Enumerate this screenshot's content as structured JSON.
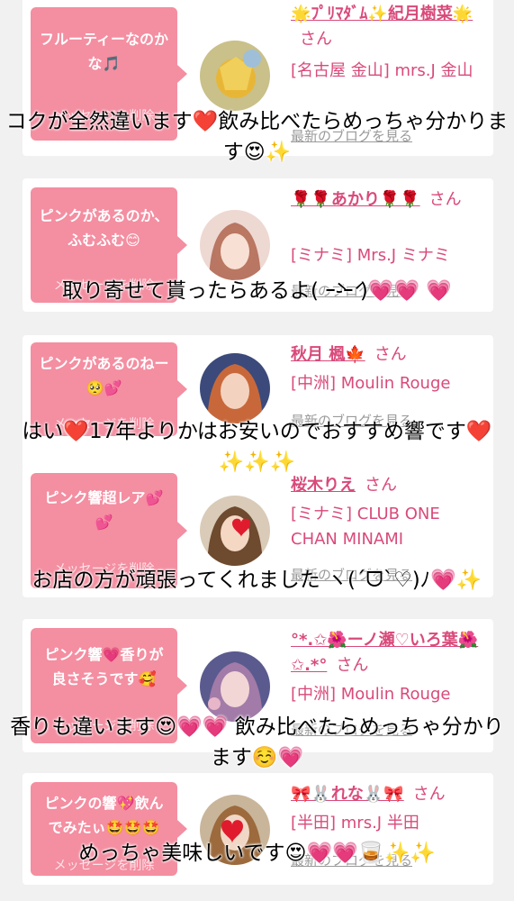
{
  "cards": [
    {
      "message": "フルーティーなのかな🎵",
      "delete_label": "メッセージを削除",
      "hostess_name": "🌟ﾌﾟﾘﾏﾀﾞﾑ✨紀月樹菜🌟",
      "san": "さん",
      "shop": "[名古屋 金山] mrs.J 金山",
      "blog_link": "最新のブログを見る",
      "overlay": "コクが全然違います❤️飲み比べたらめっちゃ分かります😍✨"
    },
    {
      "message": "ピンクがあるのか、ふむふむ😊",
      "delete_label": "メッセージを削除",
      "hostess_name": "🌹🌹あかり🌹🌹",
      "san": "さん",
      "shop": "[ミナミ] Mrs.J ミナミ",
      "blog_link": "最新のブログを見る",
      "overlay": "取り寄せて貰ったらあるよ( ｰ̀֊ｰ́ )💗💗 💗"
    },
    {
      "message": "ピンクがあるのねー🥺💕",
      "delete_label": "メッセージを削除",
      "hostess_name": "秋月 楓🍁",
      "san": "さん",
      "shop": "[中洲] Moulin Rouge",
      "blog_link": "最新のブログを見る",
      "overlay": "はい❤️17年よりかはお安いのでおすすめ響です❤️✨✨✨"
    },
    {
      "message": "ピンク響超レア💕💕",
      "delete_label": "メッセージを削除",
      "hostess_name": "桜木りえ",
      "san": "さん",
      "shop": "[ミナミ] CLUB ONE CHAN MINAMI",
      "blog_link": "最新のブログを見る",
      "overlay": "お店の方が頑張ってくれました ヽ(ˊᗜˋ♡)ﾉ💗✨"
    },
    {
      "message": "ピンク響💗香りが良さそうです🥰",
      "delete_label": "メッセージを削除",
      "hostess_name": "°*.✩🌺ーノ瀬♡いろ葉🌺✩.*°",
      "san": "さん",
      "shop": "[中洲] Moulin Rouge",
      "blog_link": "最新のブログを見る",
      "overlay": "香りも違います😍💗💗 飲み比べたらめっちゃ分かります☺️💗"
    },
    {
      "message": "ピンクの響💖飲んでみたぃ🤩🤩🤩",
      "delete_label": "メッセージを削除",
      "hostess_name": "🎀🐰れな🐰🎀",
      "san": "さん",
      "shop": "[半田] mrs.J 半田",
      "blog_link": "最新のブログを見る",
      "overlay": "めっちゃ美味しいです😍💗💗🥃✨✨"
    }
  ],
  "colors": {
    "bubble": "#f48ea1",
    "name": "#d94a7a",
    "background": "#f1f1f1"
  }
}
